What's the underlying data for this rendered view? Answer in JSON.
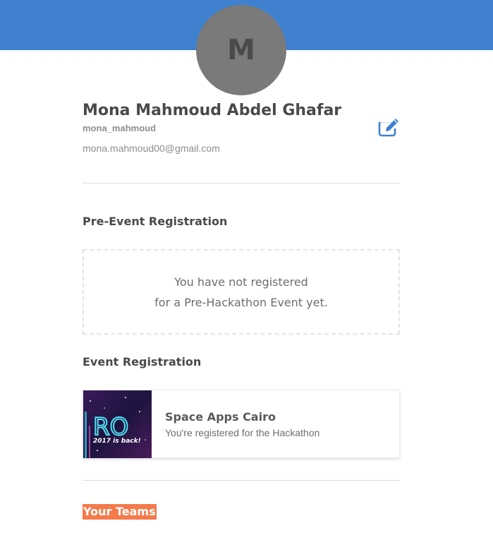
{
  "profile": {
    "avatar_letter": "M",
    "name": "Mona Mahmoud Abdel Ghafar",
    "username": "mona_mahmoud",
    "email": "mona.mahmoud00@gmail.com",
    "edit_icon": "edit-icon"
  },
  "pre_event": {
    "title": "Pre-Event Registration",
    "empty_line1": "You have not registered",
    "empty_line2": "for a Pre-Hackathon Event yet."
  },
  "event_registration": {
    "title": "Event Registration",
    "event": {
      "name": "Space Apps Cairo",
      "status": "You're registered for the Hackathon",
      "thumb_text_big": "RO",
      "thumb_text_small": "2017 is back!"
    }
  },
  "teams": {
    "title": "Your Teams"
  },
  "colors": {
    "banner": "#3f80cf",
    "accent_link": "#3f80cf",
    "teams_highlight": "#f47a4b",
    "avatar_bg": "#7a7a7a"
  }
}
